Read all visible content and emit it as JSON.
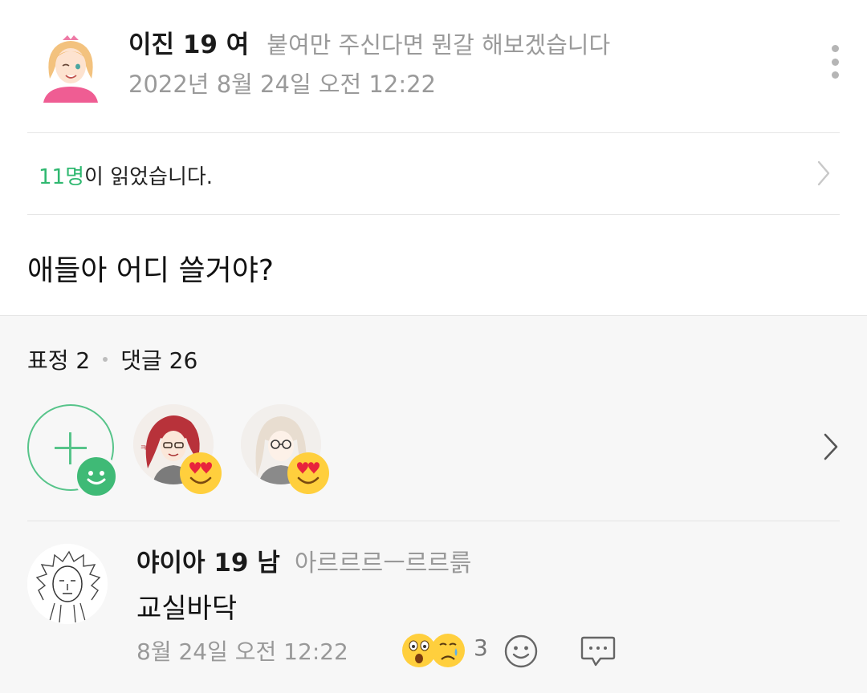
{
  "post": {
    "author_name": "이진 19 여",
    "author_status": "붙여만 주신다면 뭔갈 해보겠습니다",
    "date": "2022년 8월 24일 오전 12:22",
    "read_count": "11명",
    "read_suffix": "이 읽었습니다.",
    "body": "애들아 어디 쓸거야?"
  },
  "stats": {
    "reactions_label": "표정 2",
    "comments_label": "댓글 26"
  },
  "reactions": [
    {
      "avatar": "red-haired-girl-avatar",
      "emoji": "heart-eyes-emoji"
    },
    {
      "avatar": "glasses-girl-avatar",
      "emoji": "heart-eyes-emoji"
    }
  ],
  "comment": {
    "author_name": "야이아 19 남",
    "author_status": "아르르르ㅡ르르륽",
    "text": "교실바닥",
    "time": "8월 24일 오전 12:22",
    "emojis": [
      "surprised-emoji",
      "crying-emoji"
    ],
    "reaction_count": "3"
  },
  "colors": {
    "accent": "#2fb870",
    "muted": "#9a9a9a",
    "background_lower": "#f7f7f7"
  }
}
